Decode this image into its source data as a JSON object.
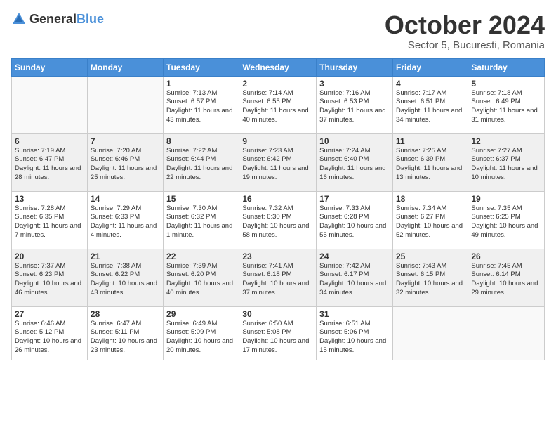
{
  "header": {
    "logo": {
      "general": "General",
      "blue": "Blue"
    },
    "title": "October 2024",
    "location": "Sector 5, Bucuresti, Romania"
  },
  "weekdays": [
    "Sunday",
    "Monday",
    "Tuesday",
    "Wednesday",
    "Thursday",
    "Friday",
    "Saturday"
  ],
  "weeks": [
    [
      {
        "day": "",
        "empty": true
      },
      {
        "day": "",
        "empty": true
      },
      {
        "day": "1",
        "info": "Sunrise: 7:13 AM\nSunset: 6:57 PM\nDaylight: 11 hours and 43 minutes."
      },
      {
        "day": "2",
        "info": "Sunrise: 7:14 AM\nSunset: 6:55 PM\nDaylight: 11 hours and 40 minutes."
      },
      {
        "day": "3",
        "info": "Sunrise: 7:16 AM\nSunset: 6:53 PM\nDaylight: 11 hours and 37 minutes."
      },
      {
        "day": "4",
        "info": "Sunrise: 7:17 AM\nSunset: 6:51 PM\nDaylight: 11 hours and 34 minutes."
      },
      {
        "day": "5",
        "info": "Sunrise: 7:18 AM\nSunset: 6:49 PM\nDaylight: 11 hours and 31 minutes."
      }
    ],
    [
      {
        "day": "6",
        "info": "Sunrise: 7:19 AM\nSunset: 6:47 PM\nDaylight: 11 hours and 28 minutes."
      },
      {
        "day": "7",
        "info": "Sunrise: 7:20 AM\nSunset: 6:46 PM\nDaylight: 11 hours and 25 minutes."
      },
      {
        "day": "8",
        "info": "Sunrise: 7:22 AM\nSunset: 6:44 PM\nDaylight: 11 hours and 22 minutes."
      },
      {
        "day": "9",
        "info": "Sunrise: 7:23 AM\nSunset: 6:42 PM\nDaylight: 11 hours and 19 minutes."
      },
      {
        "day": "10",
        "info": "Sunrise: 7:24 AM\nSunset: 6:40 PM\nDaylight: 11 hours and 16 minutes."
      },
      {
        "day": "11",
        "info": "Sunrise: 7:25 AM\nSunset: 6:39 PM\nDaylight: 11 hours and 13 minutes."
      },
      {
        "day": "12",
        "info": "Sunrise: 7:27 AM\nSunset: 6:37 PM\nDaylight: 11 hours and 10 minutes."
      }
    ],
    [
      {
        "day": "13",
        "info": "Sunrise: 7:28 AM\nSunset: 6:35 PM\nDaylight: 11 hours and 7 minutes."
      },
      {
        "day": "14",
        "info": "Sunrise: 7:29 AM\nSunset: 6:33 PM\nDaylight: 11 hours and 4 minutes."
      },
      {
        "day": "15",
        "info": "Sunrise: 7:30 AM\nSunset: 6:32 PM\nDaylight: 11 hours and 1 minute."
      },
      {
        "day": "16",
        "info": "Sunrise: 7:32 AM\nSunset: 6:30 PM\nDaylight: 10 hours and 58 minutes."
      },
      {
        "day": "17",
        "info": "Sunrise: 7:33 AM\nSunset: 6:28 PM\nDaylight: 10 hours and 55 minutes."
      },
      {
        "day": "18",
        "info": "Sunrise: 7:34 AM\nSunset: 6:27 PM\nDaylight: 10 hours and 52 minutes."
      },
      {
        "day": "19",
        "info": "Sunrise: 7:35 AM\nSunset: 6:25 PM\nDaylight: 10 hours and 49 minutes."
      }
    ],
    [
      {
        "day": "20",
        "info": "Sunrise: 7:37 AM\nSunset: 6:23 PM\nDaylight: 10 hours and 46 minutes."
      },
      {
        "day": "21",
        "info": "Sunrise: 7:38 AM\nSunset: 6:22 PM\nDaylight: 10 hours and 43 minutes."
      },
      {
        "day": "22",
        "info": "Sunrise: 7:39 AM\nSunset: 6:20 PM\nDaylight: 10 hours and 40 minutes."
      },
      {
        "day": "23",
        "info": "Sunrise: 7:41 AM\nSunset: 6:18 PM\nDaylight: 10 hours and 37 minutes."
      },
      {
        "day": "24",
        "info": "Sunrise: 7:42 AM\nSunset: 6:17 PM\nDaylight: 10 hours and 34 minutes."
      },
      {
        "day": "25",
        "info": "Sunrise: 7:43 AM\nSunset: 6:15 PM\nDaylight: 10 hours and 32 minutes."
      },
      {
        "day": "26",
        "info": "Sunrise: 7:45 AM\nSunset: 6:14 PM\nDaylight: 10 hours and 29 minutes."
      }
    ],
    [
      {
        "day": "27",
        "info": "Sunrise: 6:46 AM\nSunset: 5:12 PM\nDaylight: 10 hours and 26 minutes."
      },
      {
        "day": "28",
        "info": "Sunrise: 6:47 AM\nSunset: 5:11 PM\nDaylight: 10 hours and 23 minutes."
      },
      {
        "day": "29",
        "info": "Sunrise: 6:49 AM\nSunset: 5:09 PM\nDaylight: 10 hours and 20 minutes."
      },
      {
        "day": "30",
        "info": "Sunrise: 6:50 AM\nSunset: 5:08 PM\nDaylight: 10 hours and 17 minutes."
      },
      {
        "day": "31",
        "info": "Sunrise: 6:51 AM\nSunset: 5:06 PM\nDaylight: 10 hours and 15 minutes."
      },
      {
        "day": "",
        "empty": true
      },
      {
        "day": "",
        "empty": true
      }
    ]
  ]
}
